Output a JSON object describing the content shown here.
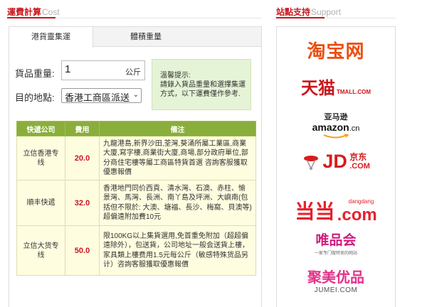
{
  "left_section": {
    "title_cn": "運費計算",
    "title_en": "Cost"
  },
  "right_section": {
    "title_cn": "站點支持",
    "title_en": "Support"
  },
  "tabs": [
    {
      "label": "港貨靈集運",
      "active": true
    },
    {
      "label": "體積重量",
      "active": false
    }
  ],
  "form": {
    "weight_label": "貨品重量:",
    "weight_value": "1",
    "weight_unit": "公斤",
    "dest_label": "目的地點:",
    "dest_value": "香港工商區派送"
  },
  "tip": {
    "title": "溫馨提示:",
    "line1": "請錄入貨品重量和選擇集運",
    "line2": "方式，以下運費僅作參考."
  },
  "table": {
    "headers": [
      "快遞公司",
      "費用",
      "備注"
    ],
    "rows": [
      {
        "name": "立信香港专线",
        "fee": "20.0",
        "note": "九龍港島,新界沙田,荃灣,葵涌所屬工業區,商業大廈,寫字樓,商業街大廈,商場,部分政府單位,部分商住宅樓等屬工商區特貨首選 咨詢客服獲取優惠報價"
      },
      {
        "name": "順丰快遞",
        "fee": "32.0",
        "note": "香港地門同价西貢、清水灣、石澳、赤柱、愉景灣、馬灣、長洲、南丫島及坪洲、大嶼南(包括但不限於: 大澳、塘福、長沙、梅窩、貝澳等)超偏遠附加費10元"
      },
      {
        "name": "立信大货专线",
        "fee": "50.0",
        "note": "限100KG以上集貨選用,免首重免附加（超超偏遠除外），包送貨，公司地址一般会送貨上樓，家具類上樓费用1.5元每公斤（敏感特殊货品另计）咨詢客服獲取優惠報價"
      }
    ]
  },
  "logos": {
    "taobao": "淘宝网",
    "tmall_cn": "天猫",
    "tmall_en": "TMALL.COM",
    "amazon_cn": "亚马逊",
    "amazon_en": "amazon",
    "amazon_suffix": ".cn",
    "jd_mark": "JD",
    "jd_cn": "京东",
    "jd_en": ".COM",
    "dangdang_small": "dangdang",
    "dangdang_com": ".com",
    "dangdang_mark": "当当",
    "vip_cn": "唯品会",
    "vip_sub": "一家专门做特卖的网站",
    "jumei_cn": "聚美优品",
    "jumei_en": "JUMEI.COM"
  },
  "colors": {
    "accent_red": "#c8161d",
    "table_header": "#8aae3b",
    "table_body": "#fffde0",
    "tip_bg": "#e5f3d6"
  }
}
